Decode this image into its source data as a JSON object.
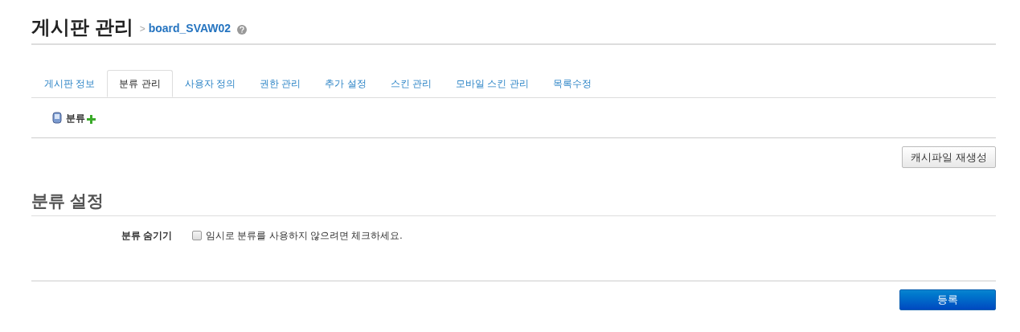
{
  "header": {
    "title": "게시판 관리",
    "separator": ">",
    "module": "board_SVAW02"
  },
  "tabs": [
    {
      "label": "게시판 정보",
      "selected": false
    },
    {
      "label": "분류 관리",
      "selected": true
    },
    {
      "label": "사용자 정의",
      "selected": false
    },
    {
      "label": "권한 관리",
      "selected": false
    },
    {
      "label": "추가 설정",
      "selected": false
    },
    {
      "label": "스킨 관리",
      "selected": false
    },
    {
      "label": "모바일 스킨 관리",
      "selected": false
    },
    {
      "label": "목록수정",
      "selected": false
    }
  ],
  "category_tree": {
    "root": "분류"
  },
  "cache_button": "캐시파일 재생성",
  "section": {
    "title": "분류 설정",
    "field_label": "분류 숨기기",
    "checkbox": {
      "label": "임시로 분류를 사용하지 않으려면 체크하세요.",
      "checked": false
    }
  },
  "submit_button": "등록"
}
